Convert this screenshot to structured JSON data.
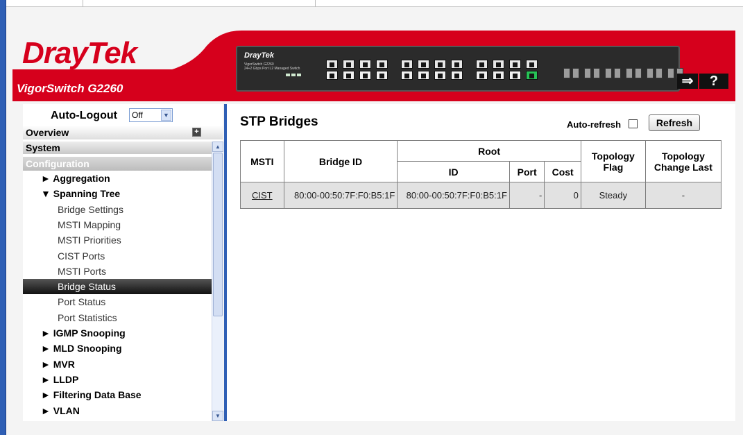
{
  "brand": {
    "logo": "DrayTek",
    "model": "VigorSwitch G2260",
    "device_brand": "DrayTek",
    "device_model": "VigorSwitch G2260",
    "device_model_sub": "24+2 Gbps Port L2 Managed Switch",
    "red": "#d6001c",
    "blue": "#2f5fb5"
  },
  "header_icons": {
    "logout": "logout-icon",
    "help": "help-icon",
    "logout_glyph": "⇒",
    "help_glyph": "?"
  },
  "sidebar": {
    "autologout_label": "Auto-Logout",
    "autologout_value": "Off",
    "sections": {
      "overview": "Overview",
      "system": "System",
      "configuration": "Configuration"
    },
    "items": [
      {
        "label": "► Aggregation",
        "type": "grp"
      },
      {
        "label": "▼ Spanning Tree",
        "type": "grp"
      },
      {
        "label": "Bridge Settings",
        "type": "sub"
      },
      {
        "label": "MSTI Mapping",
        "type": "sub"
      },
      {
        "label": "MSTI Priorities",
        "type": "sub"
      },
      {
        "label": "CIST Ports",
        "type": "sub"
      },
      {
        "label": "MSTI Ports",
        "type": "sub"
      },
      {
        "label": "Bridge Status",
        "type": "sub",
        "active": true
      },
      {
        "label": "Port Status",
        "type": "sub"
      },
      {
        "label": "Port Statistics",
        "type": "sub"
      },
      {
        "label": "► IGMP Snooping",
        "type": "grp"
      },
      {
        "label": "► MLD Snooping",
        "type": "grp"
      },
      {
        "label": "► MVR",
        "type": "grp"
      },
      {
        "label": "► LLDP",
        "type": "grp"
      },
      {
        "label": "► Filtering Data Base",
        "type": "grp"
      },
      {
        "label": "► VLAN",
        "type": "grp"
      }
    ]
  },
  "main": {
    "title": "STP Bridges",
    "autorefresh_label": "Auto-refresh",
    "autorefresh_checked": false,
    "refresh_label": "Refresh",
    "table": {
      "headers": {
        "msti": "MSTI",
        "bridge_id": "Bridge ID",
        "root": "Root",
        "root_id": "ID",
        "root_port": "Port",
        "root_cost": "Cost",
        "topology_flag": "Topology Flag",
        "topology_change_last": "Topology Change Last"
      },
      "rows": [
        {
          "msti": "CIST",
          "bridge_id": "80:00-00:50:7F:F0:B5:1F",
          "root_id": "80:00-00:50:7F:F0:B5:1F",
          "root_port": "-",
          "root_cost": "0",
          "topology_flag": "Steady",
          "topology_change_last": "-"
        }
      ]
    }
  }
}
